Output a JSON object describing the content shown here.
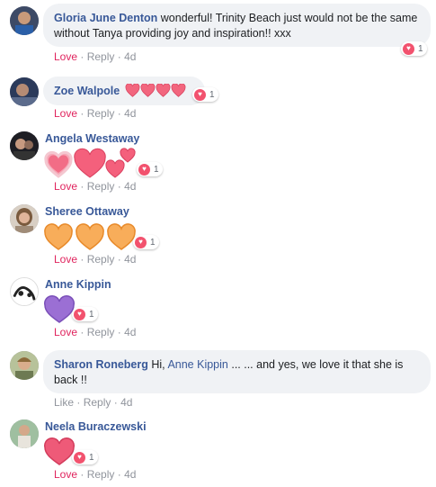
{
  "comments": [
    {
      "author": "Gloria June Denton",
      "text": "wonderful! Trinity Beach just would not be the same without Tanya providing joy and inspiration!! xxx",
      "actions": {
        "love": "Love",
        "reply": "Reply",
        "age": "4d"
      },
      "reactions": {
        "count": "1",
        "icon": "love-reaction-icon"
      }
    },
    {
      "author": "Zoe Walpole",
      "text_emoji": "pink-heart-emoji x4",
      "actions": {
        "love": "Love",
        "reply": "Reply",
        "age": "4d"
      },
      "reactions": {
        "count": "1",
        "icon": "love-reaction-icon"
      }
    },
    {
      "author": "Angela Westaway",
      "sticker": "pink-hearts-sticker",
      "actions": {
        "love": "Love",
        "reply": "Reply",
        "age": "4d"
      },
      "reactions": {
        "count": "1",
        "icon": "love-reaction-icon"
      }
    },
    {
      "author": "Sheree Ottaway",
      "sticker": "orange-hearts-sticker",
      "actions": {
        "love": "Love",
        "reply": "Reply",
        "age": "4d"
      },
      "reactions": {
        "count": "1",
        "icon": "love-reaction-icon"
      }
    },
    {
      "author": "Anne Kippin",
      "sticker": "purple-heart-sticker",
      "actions": {
        "love": "Love",
        "reply": "Reply",
        "age": "4d"
      },
      "reactions": {
        "count": "1",
        "icon": "love-reaction-icon"
      }
    },
    {
      "author": "Sharon Roneberg",
      "text_before": "Hi,",
      "mention": "Anne Kippin",
      "text_after": "... ... and yes, we love it that she is back !!",
      "actions": {
        "like": "Like",
        "reply": "Reply",
        "age": "4d"
      }
    },
    {
      "author": "Neela Buraczewski",
      "sticker": "red-heart-sticker",
      "actions": {
        "love": "Love",
        "reply": "Reply",
        "age": "4d"
      },
      "reactions": {
        "count": "1",
        "icon": "love-reaction-icon"
      }
    }
  ],
  "colors": {
    "name": "#385898",
    "love": "#e0245e",
    "meta": "#90949c",
    "bubble": "#f0f2f5",
    "heart_pink": "#f2526e",
    "heart_orange": "#f7a545",
    "heart_purple": "#9a6bd1",
    "heart_red": "#ea4c6a"
  }
}
